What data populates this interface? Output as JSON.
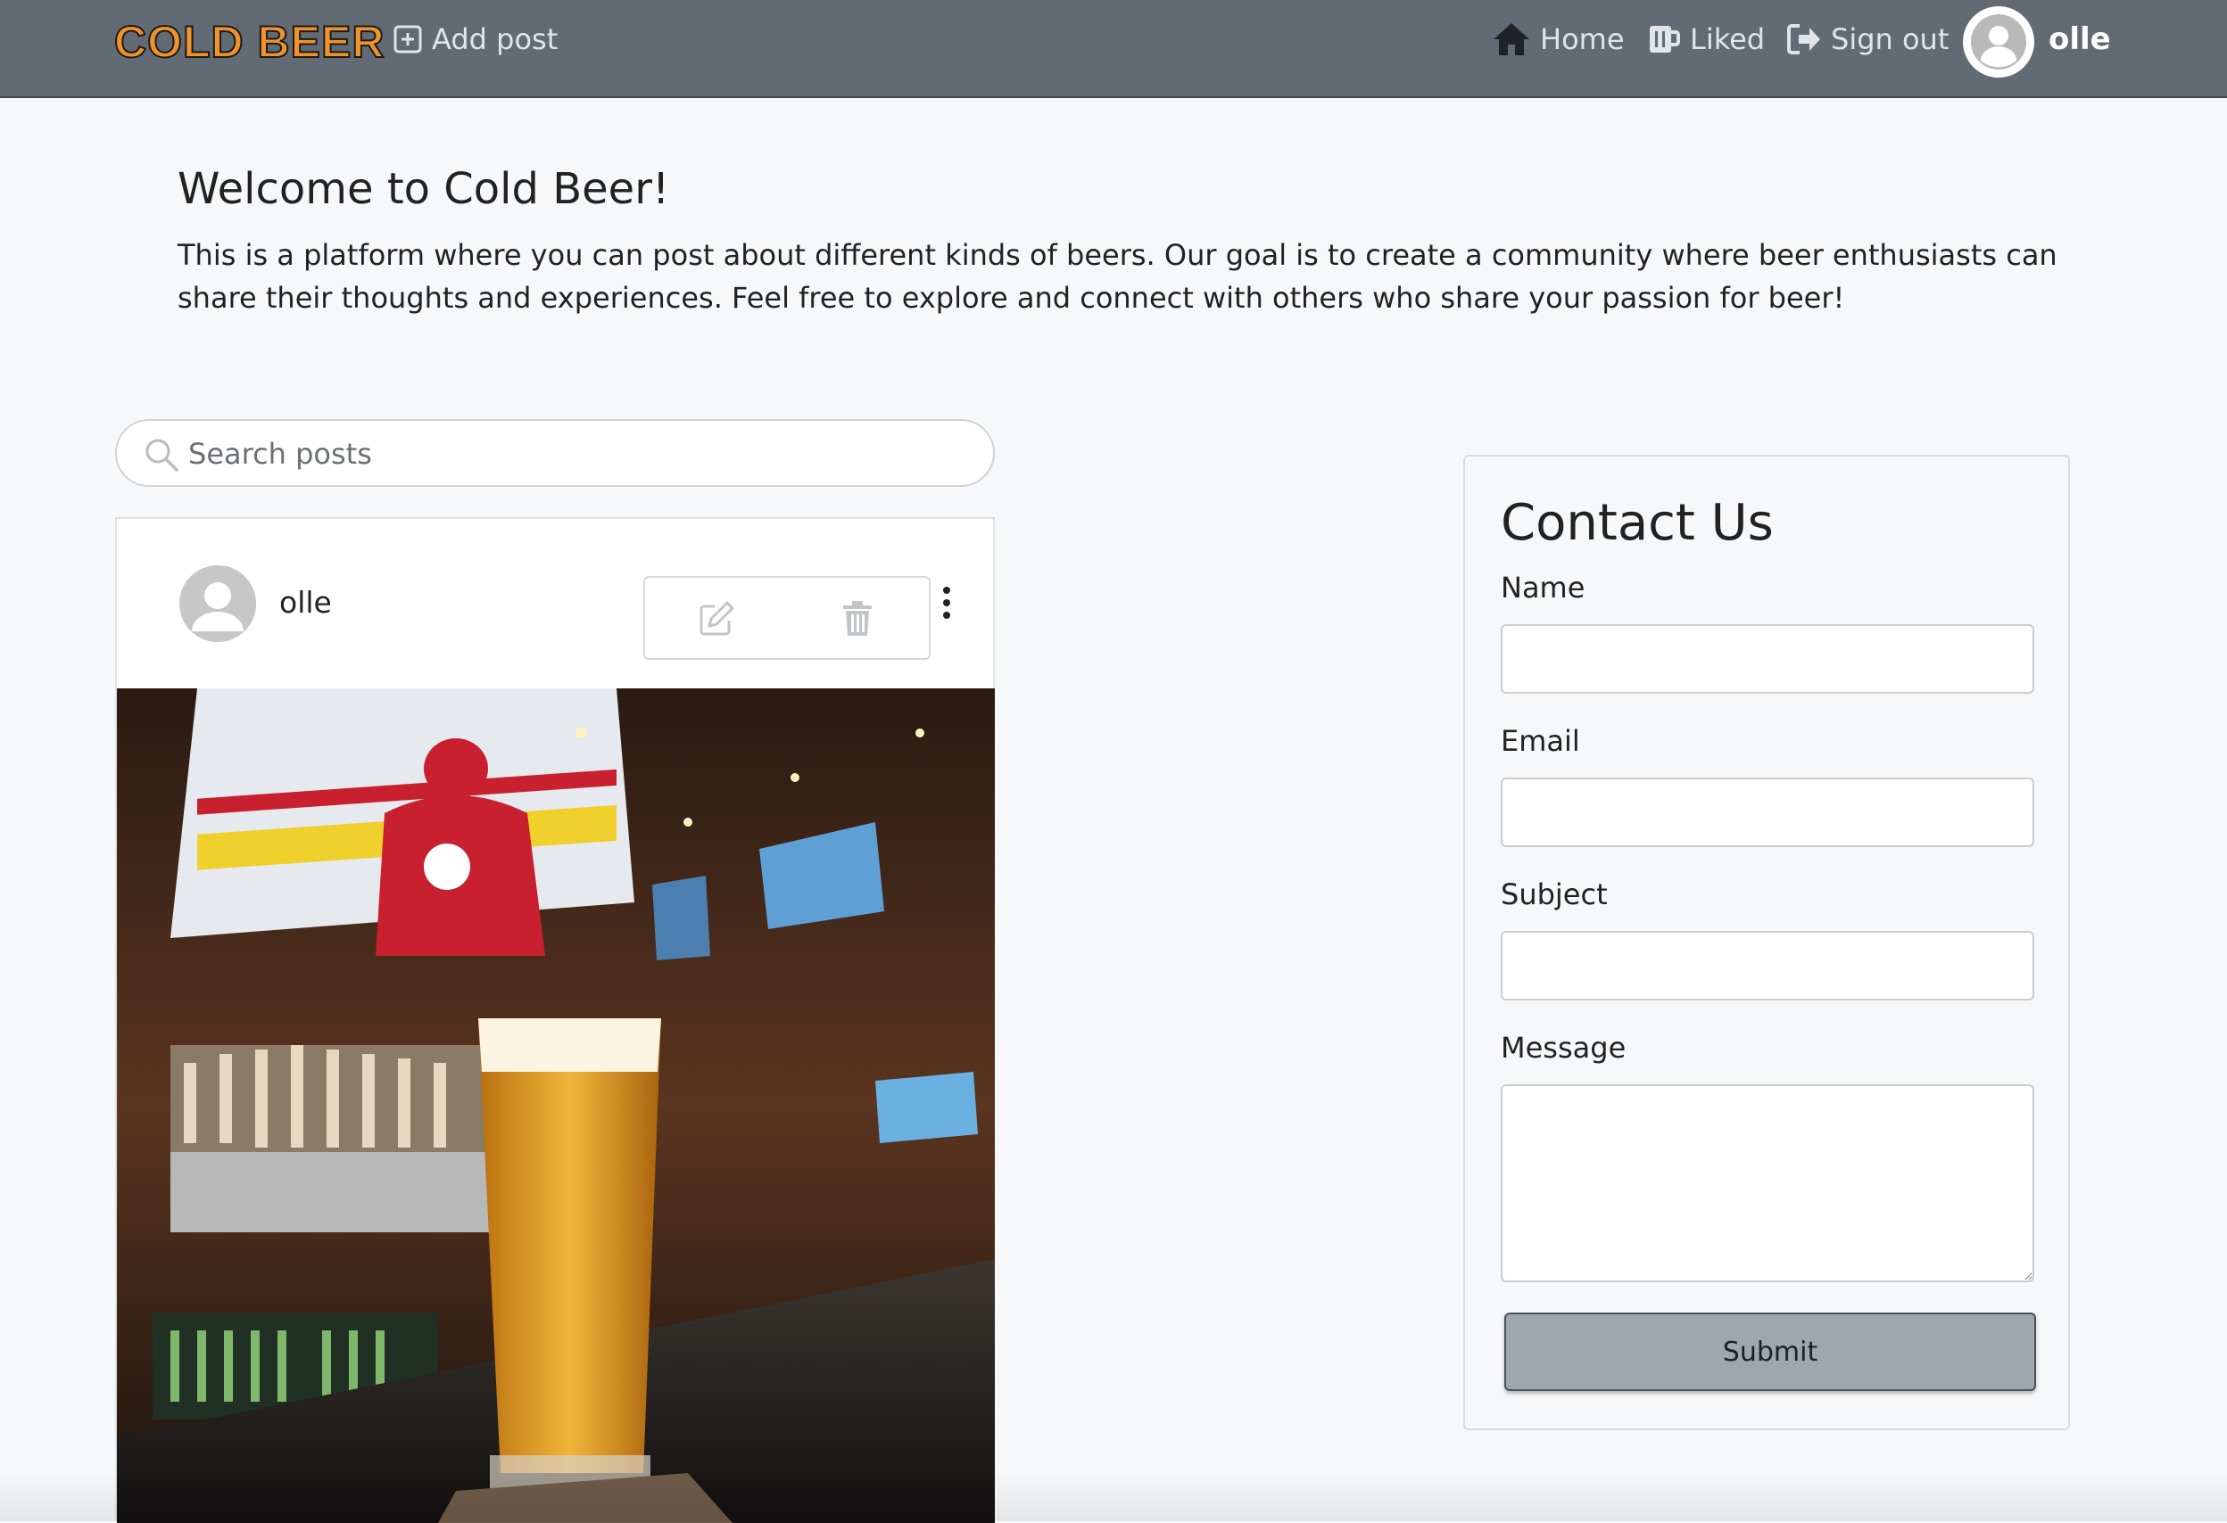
{
  "navbar": {
    "brand": "COLD BEER",
    "add_post": "Add post",
    "home": "Home",
    "liked": "Liked",
    "sign_out": "Sign out",
    "username": "olle",
    "background": "#626a74",
    "brand_color": "#f0932b"
  },
  "welcome": {
    "title": "Welcome to Cold Beer!",
    "text": "This is a platform where you can post about different kinds of beers. Our goal is to create a community where beer enthusiasts can share their thoughts and experiences. Feel free to explore and connect with others who share your passion for beer!"
  },
  "search": {
    "placeholder": "Search posts",
    "value": ""
  },
  "post": {
    "author": "olle",
    "actions": [
      "edit-icon",
      "trash-icon"
    ],
    "menu_icon": "kebab-icon"
  },
  "contact": {
    "title": "Contact Us",
    "name_label": "Name",
    "email_label": "Email",
    "subject_label": "Subject",
    "message_label": "Message",
    "submit_label": "Submit",
    "submit_color": "#a0a6ad"
  }
}
